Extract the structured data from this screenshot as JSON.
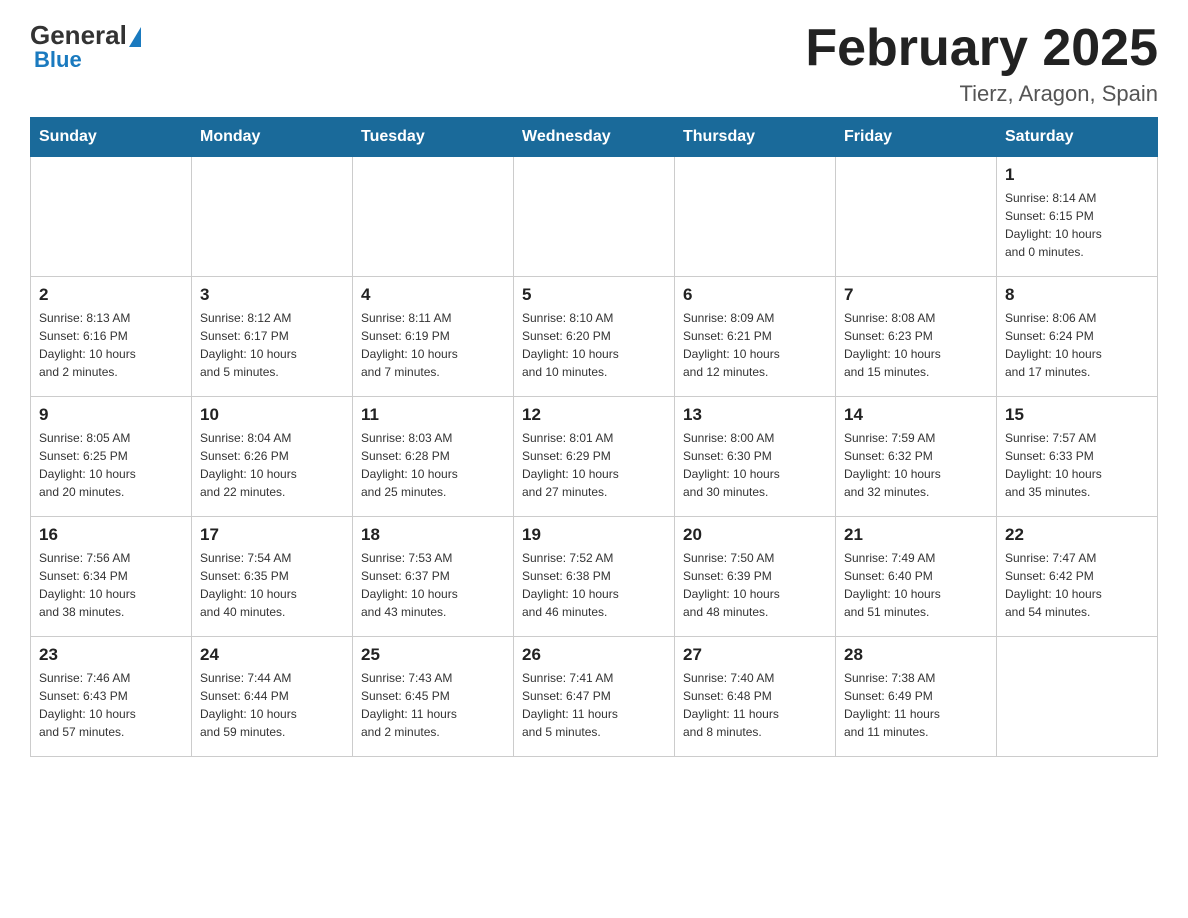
{
  "header": {
    "logo": {
      "general": "General",
      "blue": "Blue"
    },
    "title": "February 2025",
    "subtitle": "Tierz, Aragon, Spain"
  },
  "days_of_week": [
    "Sunday",
    "Monday",
    "Tuesday",
    "Wednesday",
    "Thursday",
    "Friday",
    "Saturday"
  ],
  "weeks": [
    [
      {
        "day": "",
        "info": ""
      },
      {
        "day": "",
        "info": ""
      },
      {
        "day": "",
        "info": ""
      },
      {
        "day": "",
        "info": ""
      },
      {
        "day": "",
        "info": ""
      },
      {
        "day": "",
        "info": ""
      },
      {
        "day": "1",
        "info": "Sunrise: 8:14 AM\nSunset: 6:15 PM\nDaylight: 10 hours\nand 0 minutes."
      }
    ],
    [
      {
        "day": "2",
        "info": "Sunrise: 8:13 AM\nSunset: 6:16 PM\nDaylight: 10 hours\nand 2 minutes."
      },
      {
        "day": "3",
        "info": "Sunrise: 8:12 AM\nSunset: 6:17 PM\nDaylight: 10 hours\nand 5 minutes."
      },
      {
        "day": "4",
        "info": "Sunrise: 8:11 AM\nSunset: 6:19 PM\nDaylight: 10 hours\nand 7 minutes."
      },
      {
        "day": "5",
        "info": "Sunrise: 8:10 AM\nSunset: 6:20 PM\nDaylight: 10 hours\nand 10 minutes."
      },
      {
        "day": "6",
        "info": "Sunrise: 8:09 AM\nSunset: 6:21 PM\nDaylight: 10 hours\nand 12 minutes."
      },
      {
        "day": "7",
        "info": "Sunrise: 8:08 AM\nSunset: 6:23 PM\nDaylight: 10 hours\nand 15 minutes."
      },
      {
        "day": "8",
        "info": "Sunrise: 8:06 AM\nSunset: 6:24 PM\nDaylight: 10 hours\nand 17 minutes."
      }
    ],
    [
      {
        "day": "9",
        "info": "Sunrise: 8:05 AM\nSunset: 6:25 PM\nDaylight: 10 hours\nand 20 minutes."
      },
      {
        "day": "10",
        "info": "Sunrise: 8:04 AM\nSunset: 6:26 PM\nDaylight: 10 hours\nand 22 minutes."
      },
      {
        "day": "11",
        "info": "Sunrise: 8:03 AM\nSunset: 6:28 PM\nDaylight: 10 hours\nand 25 minutes."
      },
      {
        "day": "12",
        "info": "Sunrise: 8:01 AM\nSunset: 6:29 PM\nDaylight: 10 hours\nand 27 minutes."
      },
      {
        "day": "13",
        "info": "Sunrise: 8:00 AM\nSunset: 6:30 PM\nDaylight: 10 hours\nand 30 minutes."
      },
      {
        "day": "14",
        "info": "Sunrise: 7:59 AM\nSunset: 6:32 PM\nDaylight: 10 hours\nand 32 minutes."
      },
      {
        "day": "15",
        "info": "Sunrise: 7:57 AM\nSunset: 6:33 PM\nDaylight: 10 hours\nand 35 minutes."
      }
    ],
    [
      {
        "day": "16",
        "info": "Sunrise: 7:56 AM\nSunset: 6:34 PM\nDaylight: 10 hours\nand 38 minutes."
      },
      {
        "day": "17",
        "info": "Sunrise: 7:54 AM\nSunset: 6:35 PM\nDaylight: 10 hours\nand 40 minutes."
      },
      {
        "day": "18",
        "info": "Sunrise: 7:53 AM\nSunset: 6:37 PM\nDaylight: 10 hours\nand 43 minutes."
      },
      {
        "day": "19",
        "info": "Sunrise: 7:52 AM\nSunset: 6:38 PM\nDaylight: 10 hours\nand 46 minutes."
      },
      {
        "day": "20",
        "info": "Sunrise: 7:50 AM\nSunset: 6:39 PM\nDaylight: 10 hours\nand 48 minutes."
      },
      {
        "day": "21",
        "info": "Sunrise: 7:49 AM\nSunset: 6:40 PM\nDaylight: 10 hours\nand 51 minutes."
      },
      {
        "day": "22",
        "info": "Sunrise: 7:47 AM\nSunset: 6:42 PM\nDaylight: 10 hours\nand 54 minutes."
      }
    ],
    [
      {
        "day": "23",
        "info": "Sunrise: 7:46 AM\nSunset: 6:43 PM\nDaylight: 10 hours\nand 57 minutes."
      },
      {
        "day": "24",
        "info": "Sunrise: 7:44 AM\nSunset: 6:44 PM\nDaylight: 10 hours\nand 59 minutes."
      },
      {
        "day": "25",
        "info": "Sunrise: 7:43 AM\nSunset: 6:45 PM\nDaylight: 11 hours\nand 2 minutes."
      },
      {
        "day": "26",
        "info": "Sunrise: 7:41 AM\nSunset: 6:47 PM\nDaylight: 11 hours\nand 5 minutes."
      },
      {
        "day": "27",
        "info": "Sunrise: 7:40 AM\nSunset: 6:48 PM\nDaylight: 11 hours\nand 8 minutes."
      },
      {
        "day": "28",
        "info": "Sunrise: 7:38 AM\nSunset: 6:49 PM\nDaylight: 11 hours\nand 11 minutes."
      },
      {
        "day": "",
        "info": ""
      }
    ]
  ]
}
